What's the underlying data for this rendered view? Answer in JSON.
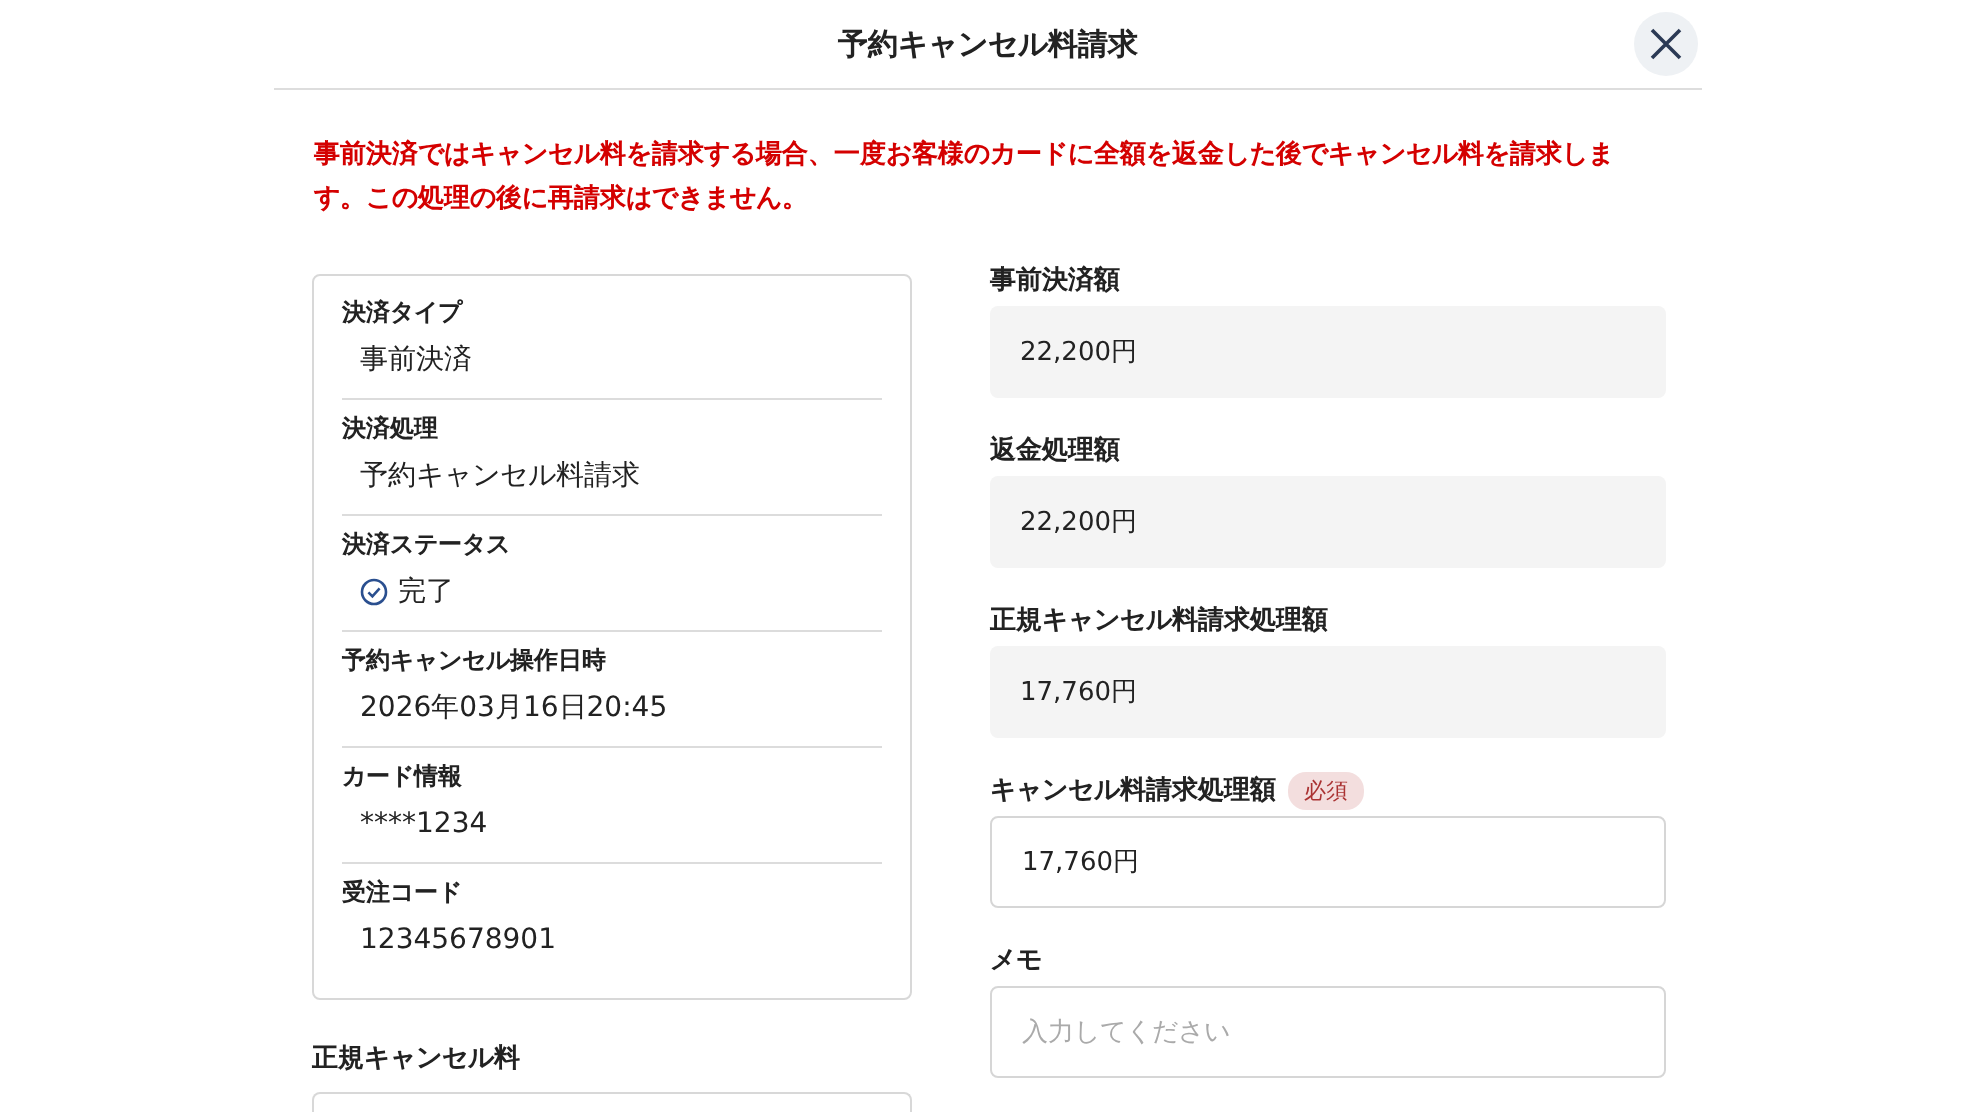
{
  "dialog": {
    "title": "予約キャンセル料請求"
  },
  "notice": "事前決済ではキャンセル料を請求する場合、一度お客様のカードに全額を返金した後でキャンセル料を請求します。この処理の後に再請求はできません。",
  "details": [
    {
      "label": "決済タイプ",
      "value": "事前決済",
      "kind": "text"
    },
    {
      "label": "決済処理",
      "value": "予約キャンセル料請求",
      "kind": "text"
    },
    {
      "label": "決済ステータス",
      "value": "完了",
      "kind": "status"
    },
    {
      "label": "予約キャンセル操作日時",
      "value": "2026年03月16日20:45",
      "kind": "text"
    },
    {
      "label": "カード情報",
      "value": "****1234",
      "kind": "text"
    },
    {
      "label": "受注コード",
      "value": "12345678901",
      "kind": "text"
    }
  ],
  "regular_fee": {
    "label": "正規キャンセル料"
  },
  "amounts": [
    {
      "label": "事前決済額",
      "value": "22,200円",
      "kind": "readonly"
    },
    {
      "label": "返金処理額",
      "value": "22,200円",
      "kind": "readonly"
    },
    {
      "label": "正規キャンセル料請求処理額",
      "value": "17,760円",
      "kind": "readonly"
    },
    {
      "label": "キャンセル料請求処理額",
      "value": "17,760円",
      "kind": "input",
      "badge": "必須"
    },
    {
      "label": "メモ",
      "placeholder": "入力してください",
      "kind": "input"
    }
  ]
}
